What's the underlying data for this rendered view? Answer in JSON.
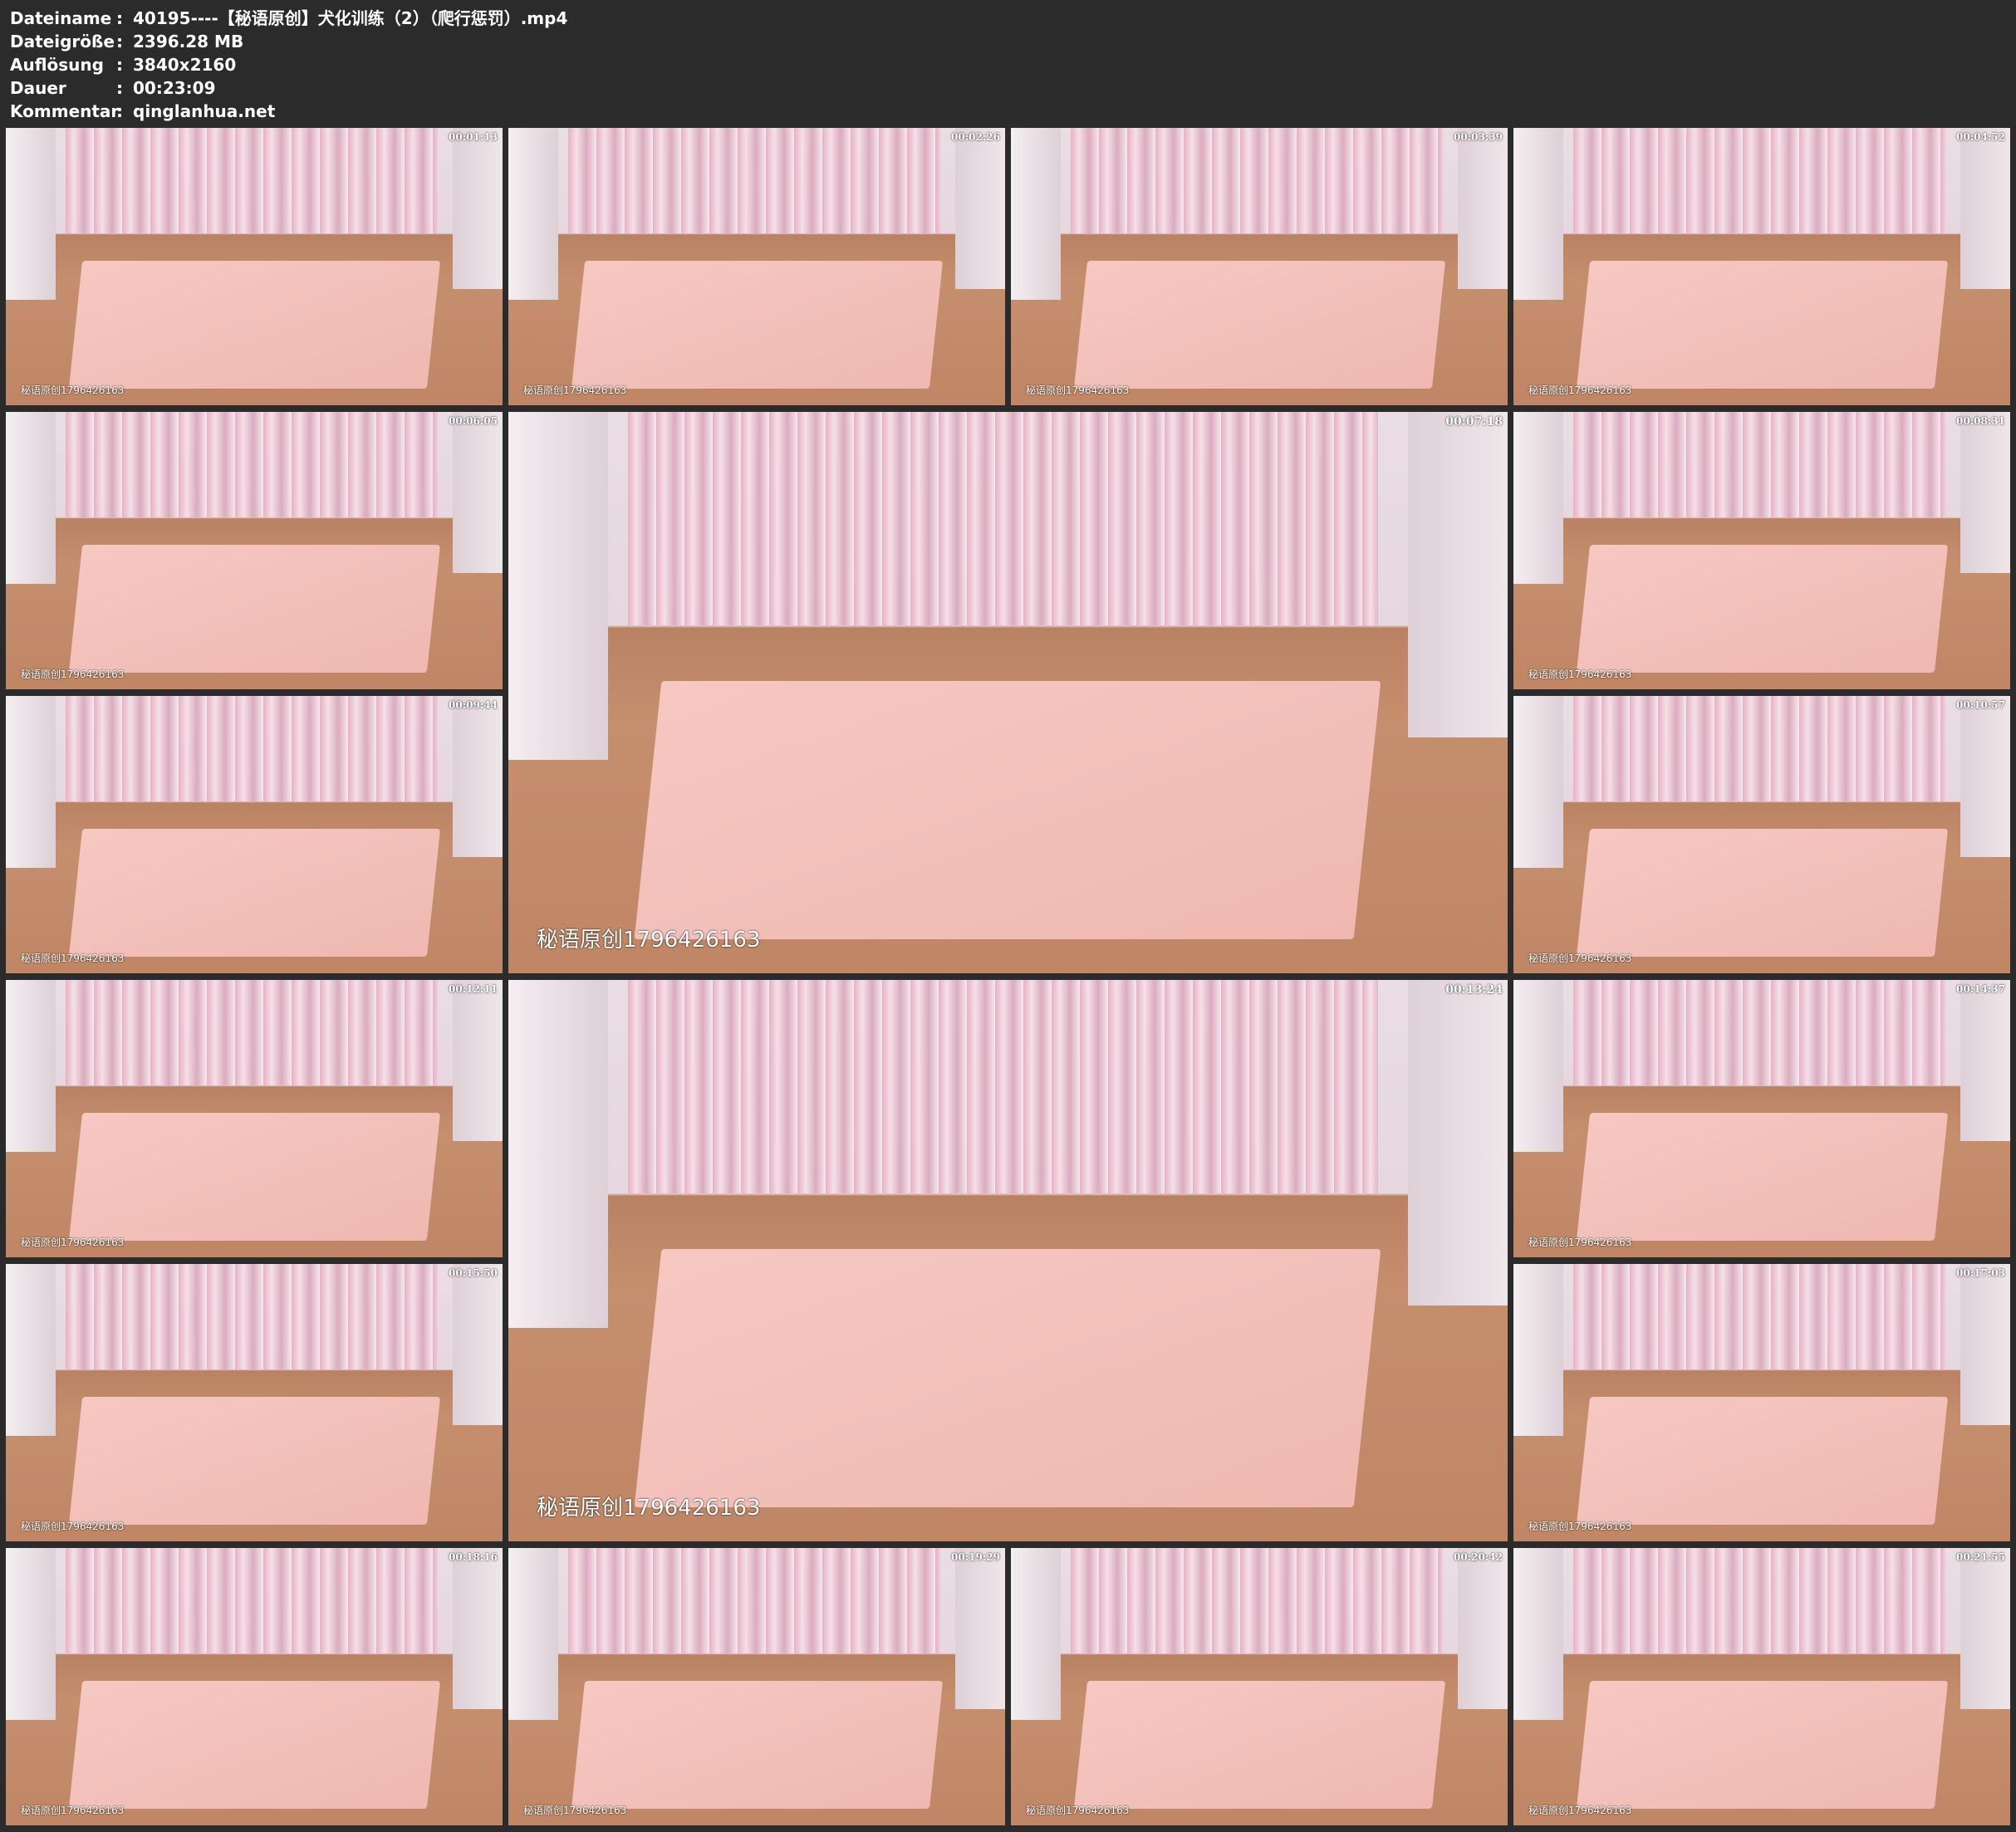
{
  "header": {
    "fields": [
      {
        "label": "Dateiname",
        "sep": ":",
        "value": "40195----【秘语原创】犬化训练（2）（爬行惩罚）.mp4"
      },
      {
        "label": "Dateigröße",
        "sep": ":",
        "value": "2396.28 MB"
      },
      {
        "label": "Auflösung",
        "sep": ":",
        "value": "3840x2160"
      },
      {
        "label": "Dauer",
        "sep": ":",
        "value": "00:23:09"
      },
      {
        "label": "Kommentar",
        "sep": ":",
        "value": "qinglanhua.net"
      }
    ]
  },
  "watermark": "秘语原创1796426163",
  "thumbnails": [
    {
      "time": "00:01:13"
    },
    {
      "time": "00:02:26"
    },
    {
      "time": "00:03:39"
    },
    {
      "time": "00:04:52"
    },
    {
      "time": "00:06:05"
    },
    {
      "time": "00:07:18"
    },
    {
      "time": "00:08:31"
    },
    {
      "time": "00:09:44"
    },
    {
      "time": "00:10:57"
    },
    {
      "time": "00:12:11"
    },
    {
      "time": "00:13:24"
    },
    {
      "time": "00:14:37"
    },
    {
      "time": "00:15:50"
    },
    {
      "time": "00:17:03"
    },
    {
      "time": "00:18:16"
    },
    {
      "time": "00:19:29"
    },
    {
      "time": "00:20:42"
    },
    {
      "time": "00:21:55"
    }
  ]
}
